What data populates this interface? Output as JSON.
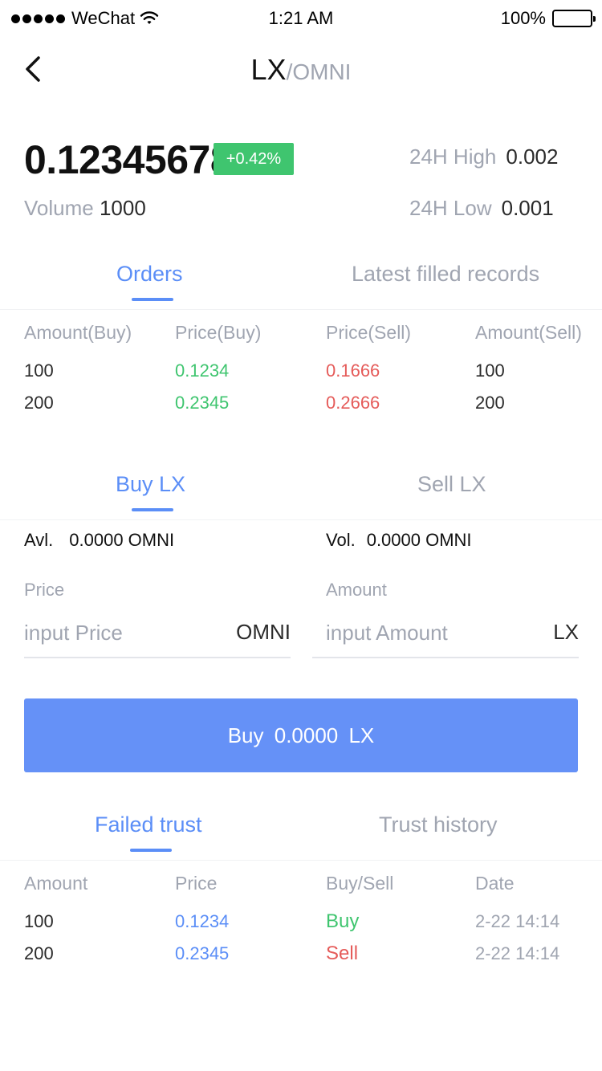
{
  "status_bar": {
    "carrier": "WeChat",
    "time": "1:21 AM",
    "battery": "100%"
  },
  "nav": {
    "base": "LX",
    "quote": "/OMNI"
  },
  "ticker": {
    "price": "0.12345678",
    "change": "+0.42%",
    "volume_label": "Volume",
    "volume": "1000",
    "high_label": "24H High",
    "high": "0.002",
    "low_label": "24H Low",
    "low": "0.001"
  },
  "book_tabs": [
    {
      "label": "Orders"
    },
    {
      "label": "Latest filled records"
    }
  ],
  "book": {
    "headers": [
      "Amount(Buy)",
      "Price(Buy)",
      "Price(Sell)",
      "Amount(Sell)"
    ],
    "rows": [
      {
        "buy_amount": "100",
        "buy_price": "0.1234",
        "sell_price": "0.1666",
        "sell_amount": "100"
      },
      {
        "buy_amount": "200",
        "buy_price": "0.2345",
        "sell_price": "0.2666",
        "sell_amount": "200"
      }
    ]
  },
  "trade_tabs": [
    {
      "label": "Buy LX"
    },
    {
      "label": "Sell LX"
    }
  ],
  "trade": {
    "avl_label": "Avl.",
    "avl_value": "0.0000 OMNI",
    "vol_label": "Vol.",
    "vol_value": "0.0000 OMNI",
    "price_label": "Price",
    "price_placeholder": "input Price",
    "price_unit": "OMNI",
    "amount_label": "Amount",
    "amount_placeholder": "input Amount",
    "amount_unit": "LX",
    "button_label": "Buy  0.0000 LX"
  },
  "trust_tabs": [
    {
      "label": "Failed trust"
    },
    {
      "label": "Trust history"
    }
  ],
  "trust": {
    "headers": [
      "Amount",
      "Price",
      "Buy/Sell",
      "Date"
    ],
    "rows": [
      {
        "amount": "100",
        "price": "0.1234",
        "side": "Buy",
        "date": "2-22 14:14"
      },
      {
        "amount": "200",
        "price": "0.2345",
        "side": "Sell",
        "date": "2-22 14:14"
      }
    ]
  },
  "colors": {
    "accent": "#5b8ef7",
    "button": "#6591f7",
    "up": "#3fc56f",
    "down": "#e55b59",
    "muted": "#a0a5b1"
  },
  "icons": {
    "back": "chevron-left-icon",
    "wifi": "wifi-icon",
    "battery": "battery-icon",
    "signal": "signal-dots-icon"
  }
}
